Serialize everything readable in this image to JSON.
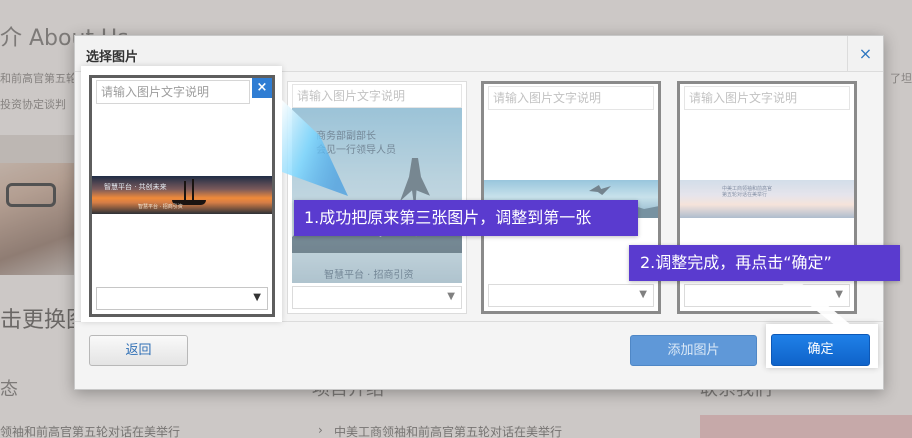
{
  "background": {
    "heading": "介 About Us",
    "intro_line1": "和前高官第五轮",
    "intro_line2": "投资协定谈判",
    "right_fragment": "了坦",
    "big_text": "击更换图",
    "section_left": "态",
    "section_mid": "项目介绍",
    "section_right": "联系我们",
    "news_left": "领袖和前高官第五轮对话在美举行",
    "news_mid": "中美工商领袖和前高官第五轮对话在美举行",
    "news_mid_bullet": "›"
  },
  "dialog": {
    "title": "选择图片",
    "close_glyph": "×",
    "caption_placeholder": "请输入图片文字说明",
    "select_arrow": "▼",
    "slot1_close_glyph": "×",
    "slot1_banner_text": "智慧平台 · 共创未来",
    "slot1_banner_small": "智慧平台 · 招商引资",
    "slot2_text_line1": "商务部副部长",
    "slot2_text_line2": "会见一行领导人员",
    "slot2_text_bottom": "智慧平台 · 招商引资",
    "slot4_text_line1": "中美工商领袖和前高官",
    "slot4_text_line2": "第五轮对话在美举行",
    "back_label": "返回",
    "add_label": "添加图片",
    "ok_label": "确定"
  },
  "callouts": {
    "step1": "1.成功把原来第三张图片，调整到第一张",
    "step2": "2.调整完成，再点击“确定”"
  },
  "colors": {
    "callout_bg": "#5a3bcf",
    "primary": "#1a73e0",
    "link_blue": "#2f77c0"
  }
}
